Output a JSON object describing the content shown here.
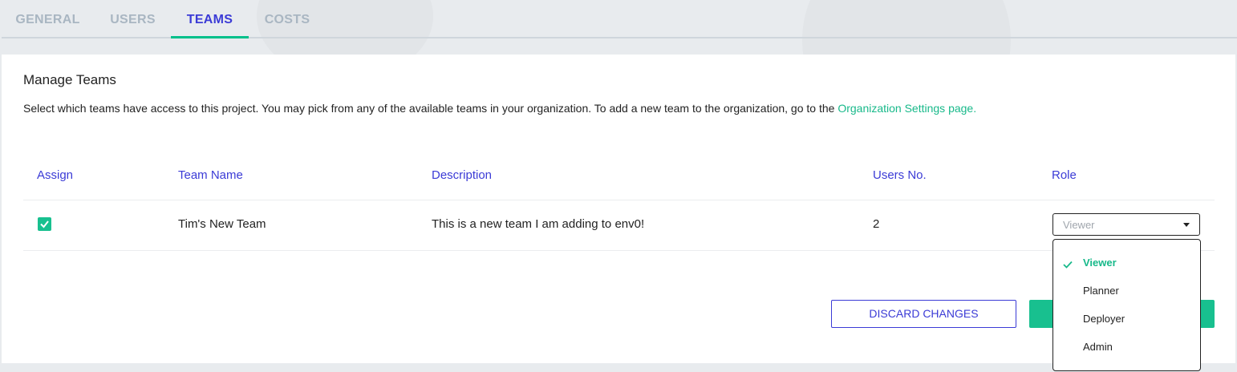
{
  "tabs": [
    {
      "label": "GENERAL",
      "active": false
    },
    {
      "label": "USERS",
      "active": false
    },
    {
      "label": "TEAMS",
      "active": true
    },
    {
      "label": "COSTS",
      "active": false
    }
  ],
  "manage": {
    "title": "Manage Teams",
    "description": "Select which teams have access to this project. You may pick from any of the available teams in your organization. To add a new team to the organization, go to the ",
    "link": "Organization Settings page."
  },
  "table": {
    "headers": [
      "Assign",
      "Team Name",
      "Description",
      "Users No.",
      "Role"
    ],
    "rows": [
      {
        "assigned": true,
        "team_name": "Tim's New Team",
        "description": "This is a new team I am adding to env0!",
        "users": "2",
        "role": "Viewer"
      }
    ]
  },
  "actions": {
    "discard": "DISCARD CHANGES",
    "save": ""
  },
  "role_dropdown": {
    "options": [
      "Viewer",
      "Planner",
      "Deployer",
      "Admin"
    ],
    "selected": "Viewer"
  },
  "colors": {
    "accent_blue": "#3b3bd6",
    "accent_green": "#18c08f",
    "tab_inactive": "#a9b6c2"
  }
}
